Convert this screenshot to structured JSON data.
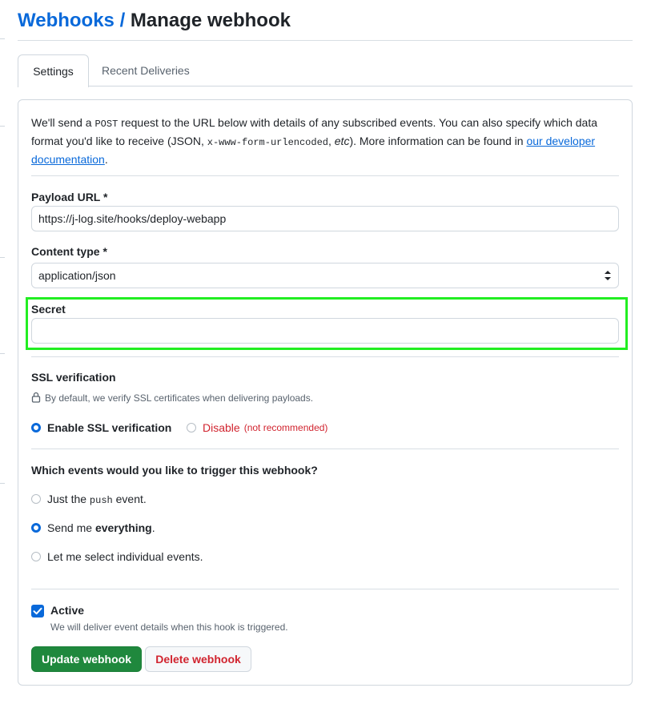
{
  "breadcrumb": {
    "parent": "Webhooks",
    "separator": " / ",
    "current": "Manage webhook"
  },
  "tabs": [
    {
      "label": "Settings",
      "active": true
    },
    {
      "label": "Recent Deliveries",
      "active": false
    }
  ],
  "intro": {
    "p1": "We'll send a ",
    "code1": "POST",
    "p2": " request to the URL below with details of any subscribed events. You can also specify which data format you'd like to receive (JSON, ",
    "code2": "x-www-form-urlencoded",
    "p3": ", ",
    "etc": "etc",
    "p4": "). More information can be found in ",
    "link": "our developer documentation",
    "p5": "."
  },
  "payload_url": {
    "label": "Payload URL *",
    "value": "https://j-log.site/hooks/deploy-webapp"
  },
  "content_type": {
    "label": "Content type *",
    "value": "application/json"
  },
  "secret": {
    "label": "Secret",
    "value": ""
  },
  "ssl": {
    "title": "SSL verification",
    "note": "By default, we verify SSL certificates when delivering payloads.",
    "enable_label": "Enable SSL verification",
    "disable_label": "Disable",
    "disable_note": "(not recommended)",
    "selected": "enable"
  },
  "events": {
    "question": "Which events would you like to trigger this webhook?",
    "option1_pre": "Just the ",
    "option1_code": "push",
    "option1_post": " event.",
    "option2_pre": "Send me ",
    "option2_strong": "everything",
    "option2_post": ".",
    "option3": "Let me select individual events.",
    "selected": "everything"
  },
  "active": {
    "label": "Active",
    "note": "We will deliver event details when this hook is triggered.",
    "checked": true
  },
  "buttons": {
    "update": "Update webhook",
    "delete": "Delete webhook"
  },
  "colors": {
    "accent": "#0969da",
    "primary_button": "#1f883d",
    "danger": "#d1242f",
    "highlight": "#22ee22"
  },
  "icons": {
    "lock": "lock-icon",
    "select": "select-arrows-icon",
    "check": "checkmark-icon"
  }
}
